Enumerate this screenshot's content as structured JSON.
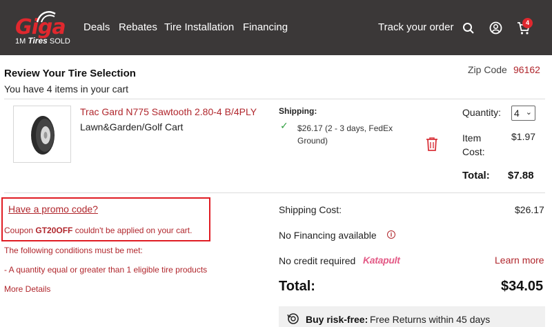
{
  "header": {
    "logo_word": "Giga",
    "logo_sub_prefix": "1M",
    "logo_sub_brand": "Tires",
    "logo_sub_suffix": "SOLD",
    "nav": [
      "Deals",
      "Rebates",
      "Tire Installation",
      "Financing"
    ],
    "track_order": "Track your order",
    "cart_count": "4",
    "icons": [
      "search-icon",
      "account-icon",
      "cart-icon"
    ]
  },
  "review": {
    "title": "Review Your Tire Selection",
    "subtitle": "You have 4 items in your cart",
    "zip_label": "Zip Code",
    "zip_value": "96162"
  },
  "item": {
    "name": "Trac Gard N775 Sawtooth 2.80-4 B/4PLY",
    "category": "Lawn&Garden/Golf Cart",
    "shipping_heading": "Shipping:",
    "shipping_detail": "$26.17  (2 - 3 days, FedEx Ground)",
    "quantity_label": "Quantity:",
    "quantity_value": "4",
    "item_cost_label": "Item Cost:",
    "item_cost_value": "$1.97",
    "total_label": "Total:",
    "total_value": "$7.88"
  },
  "promo": {
    "link": "Have a promo code?",
    "coupon_prefix": "Coupon ",
    "coupon_code": "GT20OFF",
    "coupon_suffix": " couldn't be applied on your cart.",
    "conditions_heading": "The following conditions must be met:",
    "condition_1": "- A quantity equal or greater than 1 eligible tire products",
    "more_details": "More Details"
  },
  "summary": {
    "shipping_cost_label": "Shipping Cost:",
    "shipping_cost_value": "$26.17",
    "financing_label": "No Financing available",
    "credit_label": "No credit required",
    "katapult": "Katapult",
    "learn_more": "Learn more",
    "total_label": "Total:",
    "total_value": "$34.05",
    "risk_bold": "Buy risk-free:",
    "risk_text": "Free Returns within 45 days"
  },
  "colors": {
    "header_bg": "#3b3838",
    "brand_red": "#e0282e",
    "link_red": "#b0262c",
    "katapult_pink": "#e35a86",
    "check_green": "#2e9e3e"
  }
}
